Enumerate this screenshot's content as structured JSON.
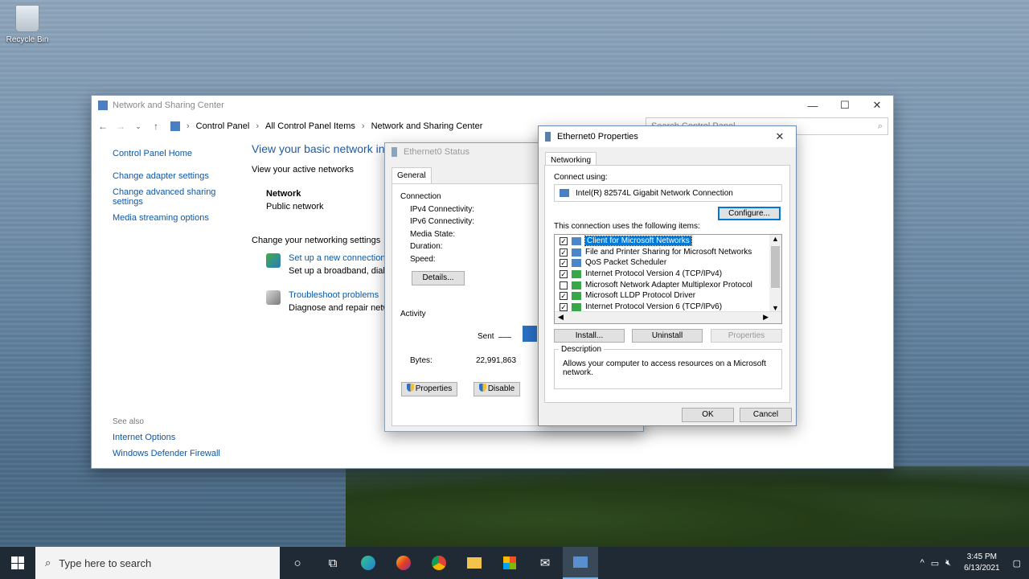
{
  "desktop": {
    "recycle_bin_label": "Recycle Bin"
  },
  "control_panel": {
    "title": "Network and Sharing Center",
    "breadcrumb": [
      "Control Panel",
      "All Control Panel Items",
      "Network and Sharing Center"
    ],
    "search_placeholder": "Search Control Panel",
    "sidebar": {
      "home": "Control Panel Home",
      "links": [
        "Change adapter settings",
        "Change advanced sharing settings",
        "Media streaming options"
      ]
    },
    "see_also": {
      "heading": "See also",
      "links": [
        "Internet Options",
        "Windows Defender Firewall"
      ]
    },
    "main": {
      "heading": "View your basic network in",
      "active_networks_label": "View your active networks",
      "network_name": "Network",
      "network_type": "Public network",
      "change_settings_label": "Change your networking settings",
      "tasks": [
        {
          "link": "Set up a new connection",
          "desc": "Set up a broadband, dial-"
        },
        {
          "link": "Troubleshoot problems",
          "desc": "Diagnose and repair netw"
        }
      ]
    }
  },
  "status_dialog": {
    "title": "Ethernet0 Status",
    "tab": "General",
    "connection_label": "Connection",
    "fields": [
      "IPv4 Connectivity:",
      "IPv6 Connectivity:",
      "Media State:",
      "Duration:",
      "Speed:"
    ],
    "details_button": "Details...",
    "activity_label": "Activity",
    "sent_label": "Sent",
    "bytes_label": "Bytes:",
    "bytes_sent": "22,991,863",
    "properties_button": "Properties",
    "disable_button": "Disable"
  },
  "properties_dialog": {
    "title": "Ethernet0 Properties",
    "tab": "Networking",
    "connect_using_label": "Connect using:",
    "adapter_name": "Intel(R) 82574L Gigabit Network Connection",
    "configure_button": "Configure...",
    "items_label": "This connection uses the following items:",
    "items": [
      {
        "label": "Client for Microsoft Networks",
        "checked": true,
        "selected": true
      },
      {
        "label": "File and Printer Sharing for Microsoft Networks",
        "checked": true,
        "selected": false
      },
      {
        "label": "QoS Packet Scheduler",
        "checked": true,
        "selected": false
      },
      {
        "label": "Internet Protocol Version 4 (TCP/IPv4)",
        "checked": true,
        "selected": false
      },
      {
        "label": "Microsoft Network Adapter Multiplexor Protocol",
        "checked": false,
        "selected": false
      },
      {
        "label": "Microsoft LLDP Protocol Driver",
        "checked": true,
        "selected": false
      },
      {
        "label": "Internet Protocol Version 6 (TCP/IPv6)",
        "checked": true,
        "selected": false
      }
    ],
    "install_button": "Install...",
    "uninstall_button": "Uninstall",
    "properties_button": "Properties",
    "description_label": "Description",
    "description_text": "Allows your computer to access resources on a Microsoft network.",
    "ok_button": "OK",
    "cancel_button": "Cancel"
  },
  "taskbar": {
    "search_placeholder": "Type here to search",
    "time": "3:45 PM",
    "date": "6/13/2021"
  }
}
